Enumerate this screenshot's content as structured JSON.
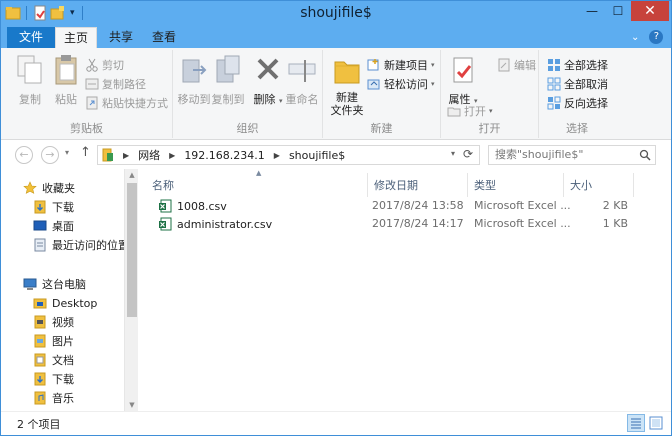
{
  "window": {
    "title": "shoujifile$"
  },
  "ribbon": {
    "tabs": {
      "file": "文件",
      "home": "主页",
      "share": "共享",
      "view": "查看"
    },
    "clipboard": {
      "label": "剪贴板",
      "copy": "复制",
      "paste": "粘贴",
      "cut": "剪切",
      "copy_path": "复制路径",
      "paste_shortcut": "粘贴快捷方式"
    },
    "organize": {
      "label": "组织",
      "move_to": "移动到",
      "copy_to": "复制到",
      "delete": "删除",
      "rename": "重命名"
    },
    "new": {
      "label": "新建",
      "new_folder": "新建\n文件夹",
      "new_item": "新建项目",
      "easy_access": "轻松访问"
    },
    "open": {
      "label": "打开",
      "properties": "属性",
      "open_btn": "打开",
      "edit": "编辑"
    },
    "select": {
      "label": "选择",
      "select_all": "全部选择",
      "select_none": "全部取消",
      "invert": "反向选择"
    }
  },
  "address": {
    "segments": [
      "网络",
      "192.168.234.1",
      "shoujifile$"
    ],
    "search_placeholder": "搜索\"shoujifile$\""
  },
  "nav": {
    "favorites": "收藏夹",
    "fav_items": [
      "下载",
      "桌面",
      "最近访问的位置"
    ],
    "this_pc": "这台电脑",
    "pc_items": [
      "Desktop",
      "视频",
      "图片",
      "文档",
      "下载",
      "音乐"
    ]
  },
  "columns": {
    "name": "名称",
    "date": "修改日期",
    "type": "类型",
    "size": "大小"
  },
  "files": [
    {
      "name": "1008.csv",
      "date": "2017/8/24 13:58",
      "type": "Microsoft Excel ...",
      "size": "2 KB"
    },
    {
      "name": "administrator.csv",
      "date": "2017/8/24 14:17",
      "type": "Microsoft Excel ...",
      "size": "1 KB"
    }
  ],
  "status": {
    "count": "2 个项目"
  },
  "colors": {
    "titlebar": "#5dadf0",
    "file_tab": "#1979ca",
    "close": "#c7433b",
    "folder": "#f0c040"
  }
}
